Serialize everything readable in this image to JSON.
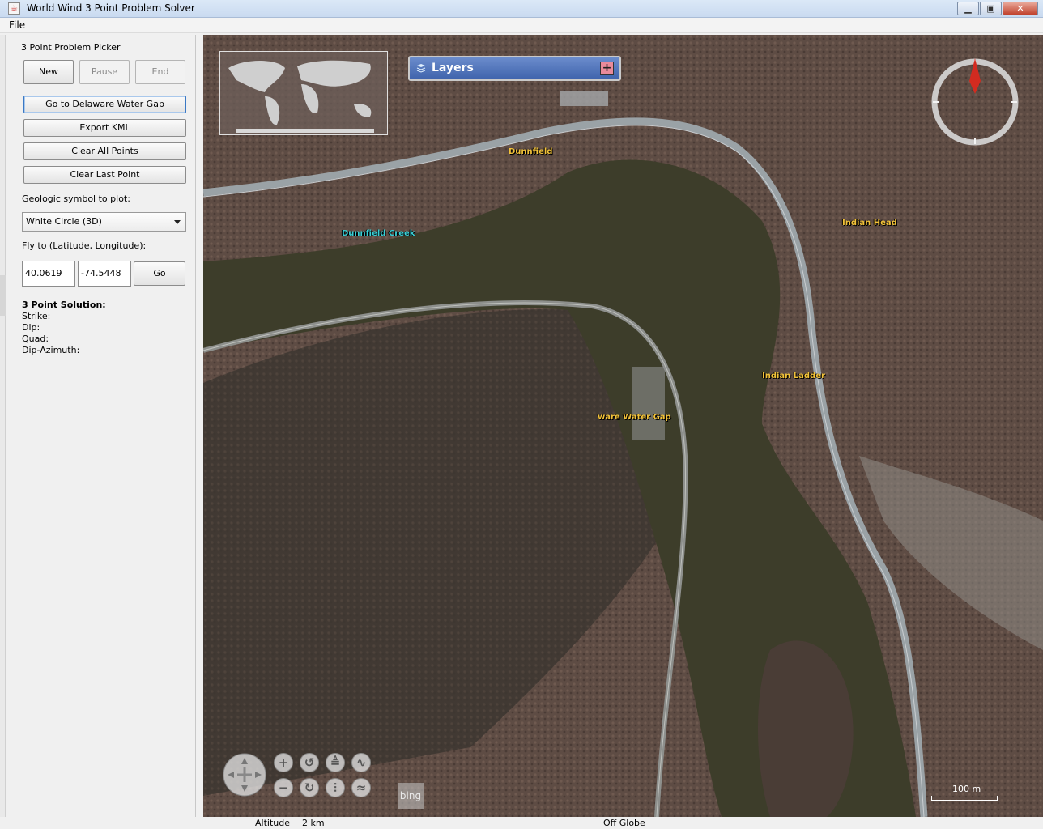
{
  "window": {
    "title": "World Wind 3 Point Problem Solver",
    "minimize_label": "▁",
    "maximize_label": "▣",
    "close_label": "✕"
  },
  "menu": {
    "file_label": "File"
  },
  "panel": {
    "picker_title": "3 Point Problem Picker",
    "new_label": "New",
    "pause_label": "Pause",
    "end_label": "End",
    "goto_label": "Go to Delaware Water Gap",
    "export_label": "Export KML",
    "clear_all_label": "Clear All Points",
    "clear_last_label": "Clear Last Point",
    "symbol_label": "Geologic symbol to plot:",
    "symbol_selected": "White Circle (3D)",
    "flyto_label": "Fly to (Latitude, Longitude):",
    "latitude_value": "40.0619",
    "longitude_value": "-74.5448",
    "go_label": "Go",
    "solution_title": "3 Point Solution:",
    "strike_label": "Strike:",
    "dip_label": "Dip:",
    "quad_label": "Quad:",
    "dip_azimuth_label": "Dip-Azimuth:"
  },
  "map": {
    "layers_label": "Layers",
    "layers_expand": "+",
    "places": {
      "dunnfield": "Dunnfield",
      "dunnfield_creek": "Dunnfield Creek",
      "indian_head": "Indian Head",
      "indian_ladder": "Indian Ladder",
      "water_gap": "ware Water Gap"
    },
    "bing_label": "bing",
    "scale_label": "100 m",
    "colors": {
      "river": "#3d3d2a",
      "terrain": "#5e4c44",
      "road": "#9aa2a6",
      "label": "#f2c23a",
      "water_label": "#3ad0d6",
      "compass_needle": "#d22b20"
    }
  },
  "status": {
    "altitude_label": "Altitude",
    "altitude_value": "2 km",
    "globe_status": "Off Globe"
  }
}
